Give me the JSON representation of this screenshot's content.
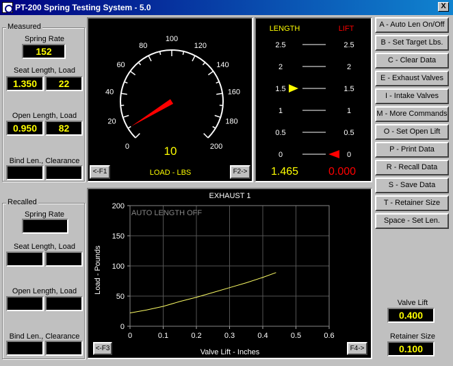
{
  "window": {
    "title": "PT-200 Spring Testing System - 5.0",
    "close_label": "X"
  },
  "measured": {
    "group_label": "Measured",
    "spring_rate_label": "Spring Rate",
    "spring_rate": "152",
    "seat_label": "Seat Length, Load",
    "seat_length": "1.350",
    "seat_load": "22",
    "open_label": "Open Length, Load",
    "open_length": "0.950",
    "open_load": "82",
    "bind_label": "Bind Len., Clearance"
  },
  "recalled": {
    "group_label": "Recalled",
    "spring_rate_label": "Spring Rate",
    "seat_label": "Seat Length, Load",
    "open_label": "Open Length, Load",
    "bind_label": "Bind Len., Clearance"
  },
  "gauge": {
    "ticks": [
      "0",
      "20",
      "40",
      "60",
      "80",
      "100",
      "120",
      "140",
      "160",
      "180",
      "200"
    ],
    "value": 10,
    "value_text": "10",
    "unit_label": "LOAD - LBS",
    "f1_label": "<-F1",
    "f2_label": "F2->",
    "colors": {
      "needle": "#ff0000",
      "value": "#ffff00",
      "unit": "#ffff00"
    }
  },
  "scale": {
    "length_header": "LENGTH",
    "lift_header": "LIFT",
    "length_ticks": [
      "2.5",
      "2",
      "1.5",
      "1",
      "0.5",
      "0"
    ],
    "lift_ticks": [
      "2.5",
      "2",
      "1.5",
      "1",
      "0.5",
      "0"
    ],
    "length_value": "1.465",
    "lift_value": "0.000",
    "length_marker": 1.5,
    "lift_marker": 0,
    "colors": {
      "length": "#ffff00",
      "lift": "#ff0000"
    }
  },
  "commands": [
    "A - Auto Len On/Off",
    "B - Set Target Lbs.",
    "C - Clear Data",
    "E - Exhaust Valves",
    "I - Intake Valves",
    "M - More Commands",
    "O - Set Open Lift",
    "P - Print Data",
    "R - Recall Data",
    "S - Save Data",
    "T - Retainer Size",
    "Space - Set Len."
  ],
  "valve_lift": {
    "label": "Valve Lift",
    "value": "0.400"
  },
  "retainer_size": {
    "label": "Retainer Size",
    "value": "0.100"
  },
  "chart": {
    "f3_label": "<-F3",
    "f4_label": "F4->",
    "status": "AUTO LENGTH OFF"
  },
  "chart_data": {
    "type": "line",
    "title": "EXHAUST 1",
    "xlabel": "Valve Lift - Inches",
    "ylabel": "Load - Pounds",
    "xlim": [
      0,
      0.6
    ],
    "ylim": [
      0,
      200
    ],
    "xticks": [
      "0",
      "0.1",
      "0.2",
      "0.3",
      "0.4",
      "0.5",
      "0.6"
    ],
    "yticks": [
      "0",
      "50",
      "100",
      "150",
      "200"
    ],
    "grid": true,
    "series": [
      {
        "x": [
          0,
          0.05,
          0.1,
          0.15,
          0.2,
          0.25,
          0.3,
          0.35,
          0.4,
          0.44
        ],
        "y": [
          22,
          27,
          33,
          41,
          48,
          56,
          64,
          72,
          81,
          89
        ]
      }
    ]
  }
}
